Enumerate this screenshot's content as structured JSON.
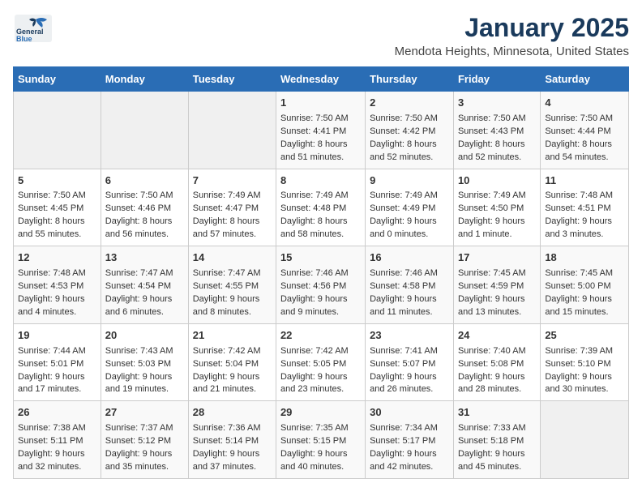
{
  "header": {
    "logo_line1": "General",
    "logo_line2": "Blue",
    "month": "January 2025",
    "location": "Mendota Heights, Minnesota, United States"
  },
  "weekdays": [
    "Sunday",
    "Monday",
    "Tuesday",
    "Wednesday",
    "Thursday",
    "Friday",
    "Saturday"
  ],
  "weeks": [
    [
      {
        "day": "",
        "text": ""
      },
      {
        "day": "",
        "text": ""
      },
      {
        "day": "",
        "text": ""
      },
      {
        "day": "1",
        "text": "Sunrise: 7:50 AM\nSunset: 4:41 PM\nDaylight: 8 hours and 51 minutes."
      },
      {
        "day": "2",
        "text": "Sunrise: 7:50 AM\nSunset: 4:42 PM\nDaylight: 8 hours and 52 minutes."
      },
      {
        "day": "3",
        "text": "Sunrise: 7:50 AM\nSunset: 4:43 PM\nDaylight: 8 hours and 52 minutes."
      },
      {
        "day": "4",
        "text": "Sunrise: 7:50 AM\nSunset: 4:44 PM\nDaylight: 8 hours and 54 minutes."
      }
    ],
    [
      {
        "day": "5",
        "text": "Sunrise: 7:50 AM\nSunset: 4:45 PM\nDaylight: 8 hours and 55 minutes."
      },
      {
        "day": "6",
        "text": "Sunrise: 7:50 AM\nSunset: 4:46 PM\nDaylight: 8 hours and 56 minutes."
      },
      {
        "day": "7",
        "text": "Sunrise: 7:49 AM\nSunset: 4:47 PM\nDaylight: 8 hours and 57 minutes."
      },
      {
        "day": "8",
        "text": "Sunrise: 7:49 AM\nSunset: 4:48 PM\nDaylight: 8 hours and 58 minutes."
      },
      {
        "day": "9",
        "text": "Sunrise: 7:49 AM\nSunset: 4:49 PM\nDaylight: 9 hours and 0 minutes."
      },
      {
        "day": "10",
        "text": "Sunrise: 7:49 AM\nSunset: 4:50 PM\nDaylight: 9 hours and 1 minute."
      },
      {
        "day": "11",
        "text": "Sunrise: 7:48 AM\nSunset: 4:51 PM\nDaylight: 9 hours and 3 minutes."
      }
    ],
    [
      {
        "day": "12",
        "text": "Sunrise: 7:48 AM\nSunset: 4:53 PM\nDaylight: 9 hours and 4 minutes."
      },
      {
        "day": "13",
        "text": "Sunrise: 7:47 AM\nSunset: 4:54 PM\nDaylight: 9 hours and 6 minutes."
      },
      {
        "day": "14",
        "text": "Sunrise: 7:47 AM\nSunset: 4:55 PM\nDaylight: 9 hours and 8 minutes."
      },
      {
        "day": "15",
        "text": "Sunrise: 7:46 AM\nSunset: 4:56 PM\nDaylight: 9 hours and 9 minutes."
      },
      {
        "day": "16",
        "text": "Sunrise: 7:46 AM\nSunset: 4:58 PM\nDaylight: 9 hours and 11 minutes."
      },
      {
        "day": "17",
        "text": "Sunrise: 7:45 AM\nSunset: 4:59 PM\nDaylight: 9 hours and 13 minutes."
      },
      {
        "day": "18",
        "text": "Sunrise: 7:45 AM\nSunset: 5:00 PM\nDaylight: 9 hours and 15 minutes."
      }
    ],
    [
      {
        "day": "19",
        "text": "Sunrise: 7:44 AM\nSunset: 5:01 PM\nDaylight: 9 hours and 17 minutes."
      },
      {
        "day": "20",
        "text": "Sunrise: 7:43 AM\nSunset: 5:03 PM\nDaylight: 9 hours and 19 minutes."
      },
      {
        "day": "21",
        "text": "Sunrise: 7:42 AM\nSunset: 5:04 PM\nDaylight: 9 hours and 21 minutes."
      },
      {
        "day": "22",
        "text": "Sunrise: 7:42 AM\nSunset: 5:05 PM\nDaylight: 9 hours and 23 minutes."
      },
      {
        "day": "23",
        "text": "Sunrise: 7:41 AM\nSunset: 5:07 PM\nDaylight: 9 hours and 26 minutes."
      },
      {
        "day": "24",
        "text": "Sunrise: 7:40 AM\nSunset: 5:08 PM\nDaylight: 9 hours and 28 minutes."
      },
      {
        "day": "25",
        "text": "Sunrise: 7:39 AM\nSunset: 5:10 PM\nDaylight: 9 hours and 30 minutes."
      }
    ],
    [
      {
        "day": "26",
        "text": "Sunrise: 7:38 AM\nSunset: 5:11 PM\nDaylight: 9 hours and 32 minutes."
      },
      {
        "day": "27",
        "text": "Sunrise: 7:37 AM\nSunset: 5:12 PM\nDaylight: 9 hours and 35 minutes."
      },
      {
        "day": "28",
        "text": "Sunrise: 7:36 AM\nSunset: 5:14 PM\nDaylight: 9 hours and 37 minutes."
      },
      {
        "day": "29",
        "text": "Sunrise: 7:35 AM\nSunset: 5:15 PM\nDaylight: 9 hours and 40 minutes."
      },
      {
        "day": "30",
        "text": "Sunrise: 7:34 AM\nSunset: 5:17 PM\nDaylight: 9 hours and 42 minutes."
      },
      {
        "day": "31",
        "text": "Sunrise: 7:33 AM\nSunset: 5:18 PM\nDaylight: 9 hours and 45 minutes."
      },
      {
        "day": "",
        "text": ""
      }
    ]
  ]
}
